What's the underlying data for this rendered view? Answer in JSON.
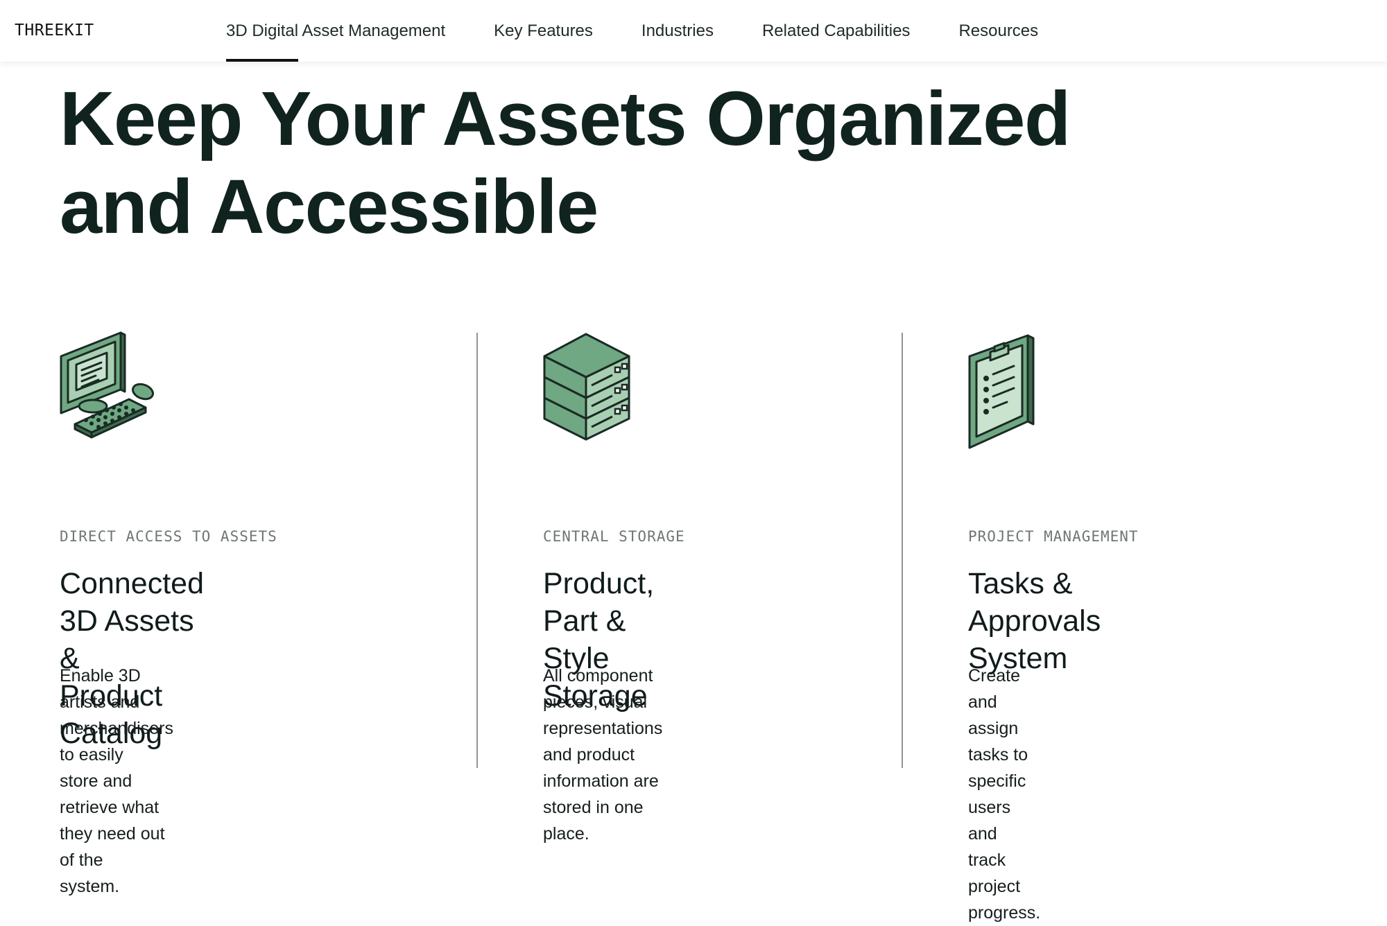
{
  "header": {
    "logo": "THREEKIT",
    "nav": [
      {
        "label": "3D Digital Asset Management",
        "active": true
      },
      {
        "label": "Key Features",
        "active": false
      },
      {
        "label": "Industries",
        "active": false
      },
      {
        "label": "Related Capabilities",
        "active": false
      },
      {
        "label": "Resources",
        "active": false
      }
    ]
  },
  "hero": {
    "line1": "Keep Your Assets Organized",
    "line2": "and Accessible"
  },
  "features": [
    {
      "icon": "computer-icon",
      "kicker": "DIRECT ACCESS TO ASSETS",
      "title_line1": "Connected 3D Assets &",
      "title_line2": "Product Catalog",
      "desc_line1": "Enable 3D artists and merchandisers to easily",
      "desc_line2": "store and retrieve what they need out of the",
      "desc_line3": "system."
    },
    {
      "icon": "server-stack-icon",
      "kicker": "CENTRAL STORAGE",
      "title_line1": "Product, Part & Style",
      "title_line2": "Storage",
      "desc_line1": "All component pieces, visual",
      "desc_line2": "representations and product",
      "desc_line3": "information are stored in one place."
    },
    {
      "icon": "clipboard-icon",
      "kicker": "PROJECT MANAGEMENT",
      "title_line1": "Tasks & Approvals",
      "title_line2": "System",
      "desc_line1": "Create and assign tasks to specific users and",
      "desc_line2": "track project progress.",
      "desc_line3": ""
    }
  ],
  "colors": {
    "brand_green": "#6fa882",
    "brand_green_light": "#a9cfb2",
    "ink": "#10231f"
  }
}
